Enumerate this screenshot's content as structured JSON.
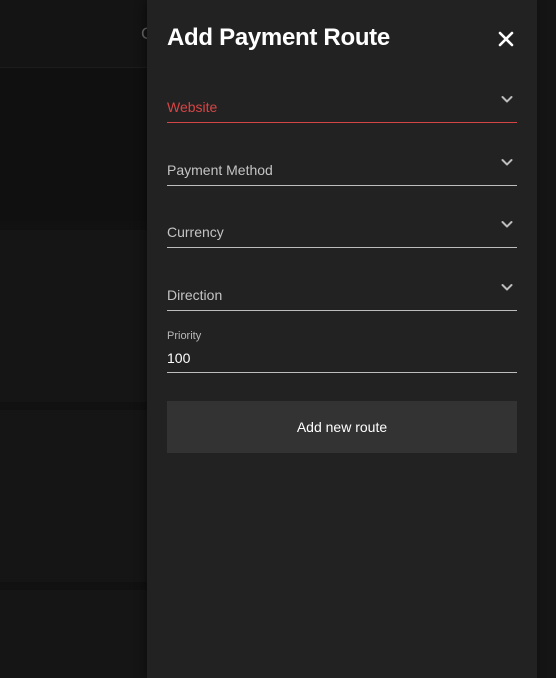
{
  "background": {
    "header_glyph": "C"
  },
  "drawer": {
    "title": "Add Payment Route",
    "close_icon": "close-icon",
    "fields": [
      {
        "label": "Website",
        "state": "error",
        "icon": "chevron-down-icon"
      },
      {
        "label": "Payment Method",
        "icon": "chevron-down-icon"
      },
      {
        "label": "Currency",
        "icon": "chevron-down-icon"
      },
      {
        "label": "Direction",
        "icon": "chevron-down-icon"
      }
    ],
    "priority": {
      "label": "Priority",
      "value": "100"
    },
    "submit_label": "Add new route"
  },
  "colors": {
    "drawer_bg": "#222222",
    "error": "#d64545",
    "button_bg": "#333333",
    "text": "#ffffff"
  }
}
